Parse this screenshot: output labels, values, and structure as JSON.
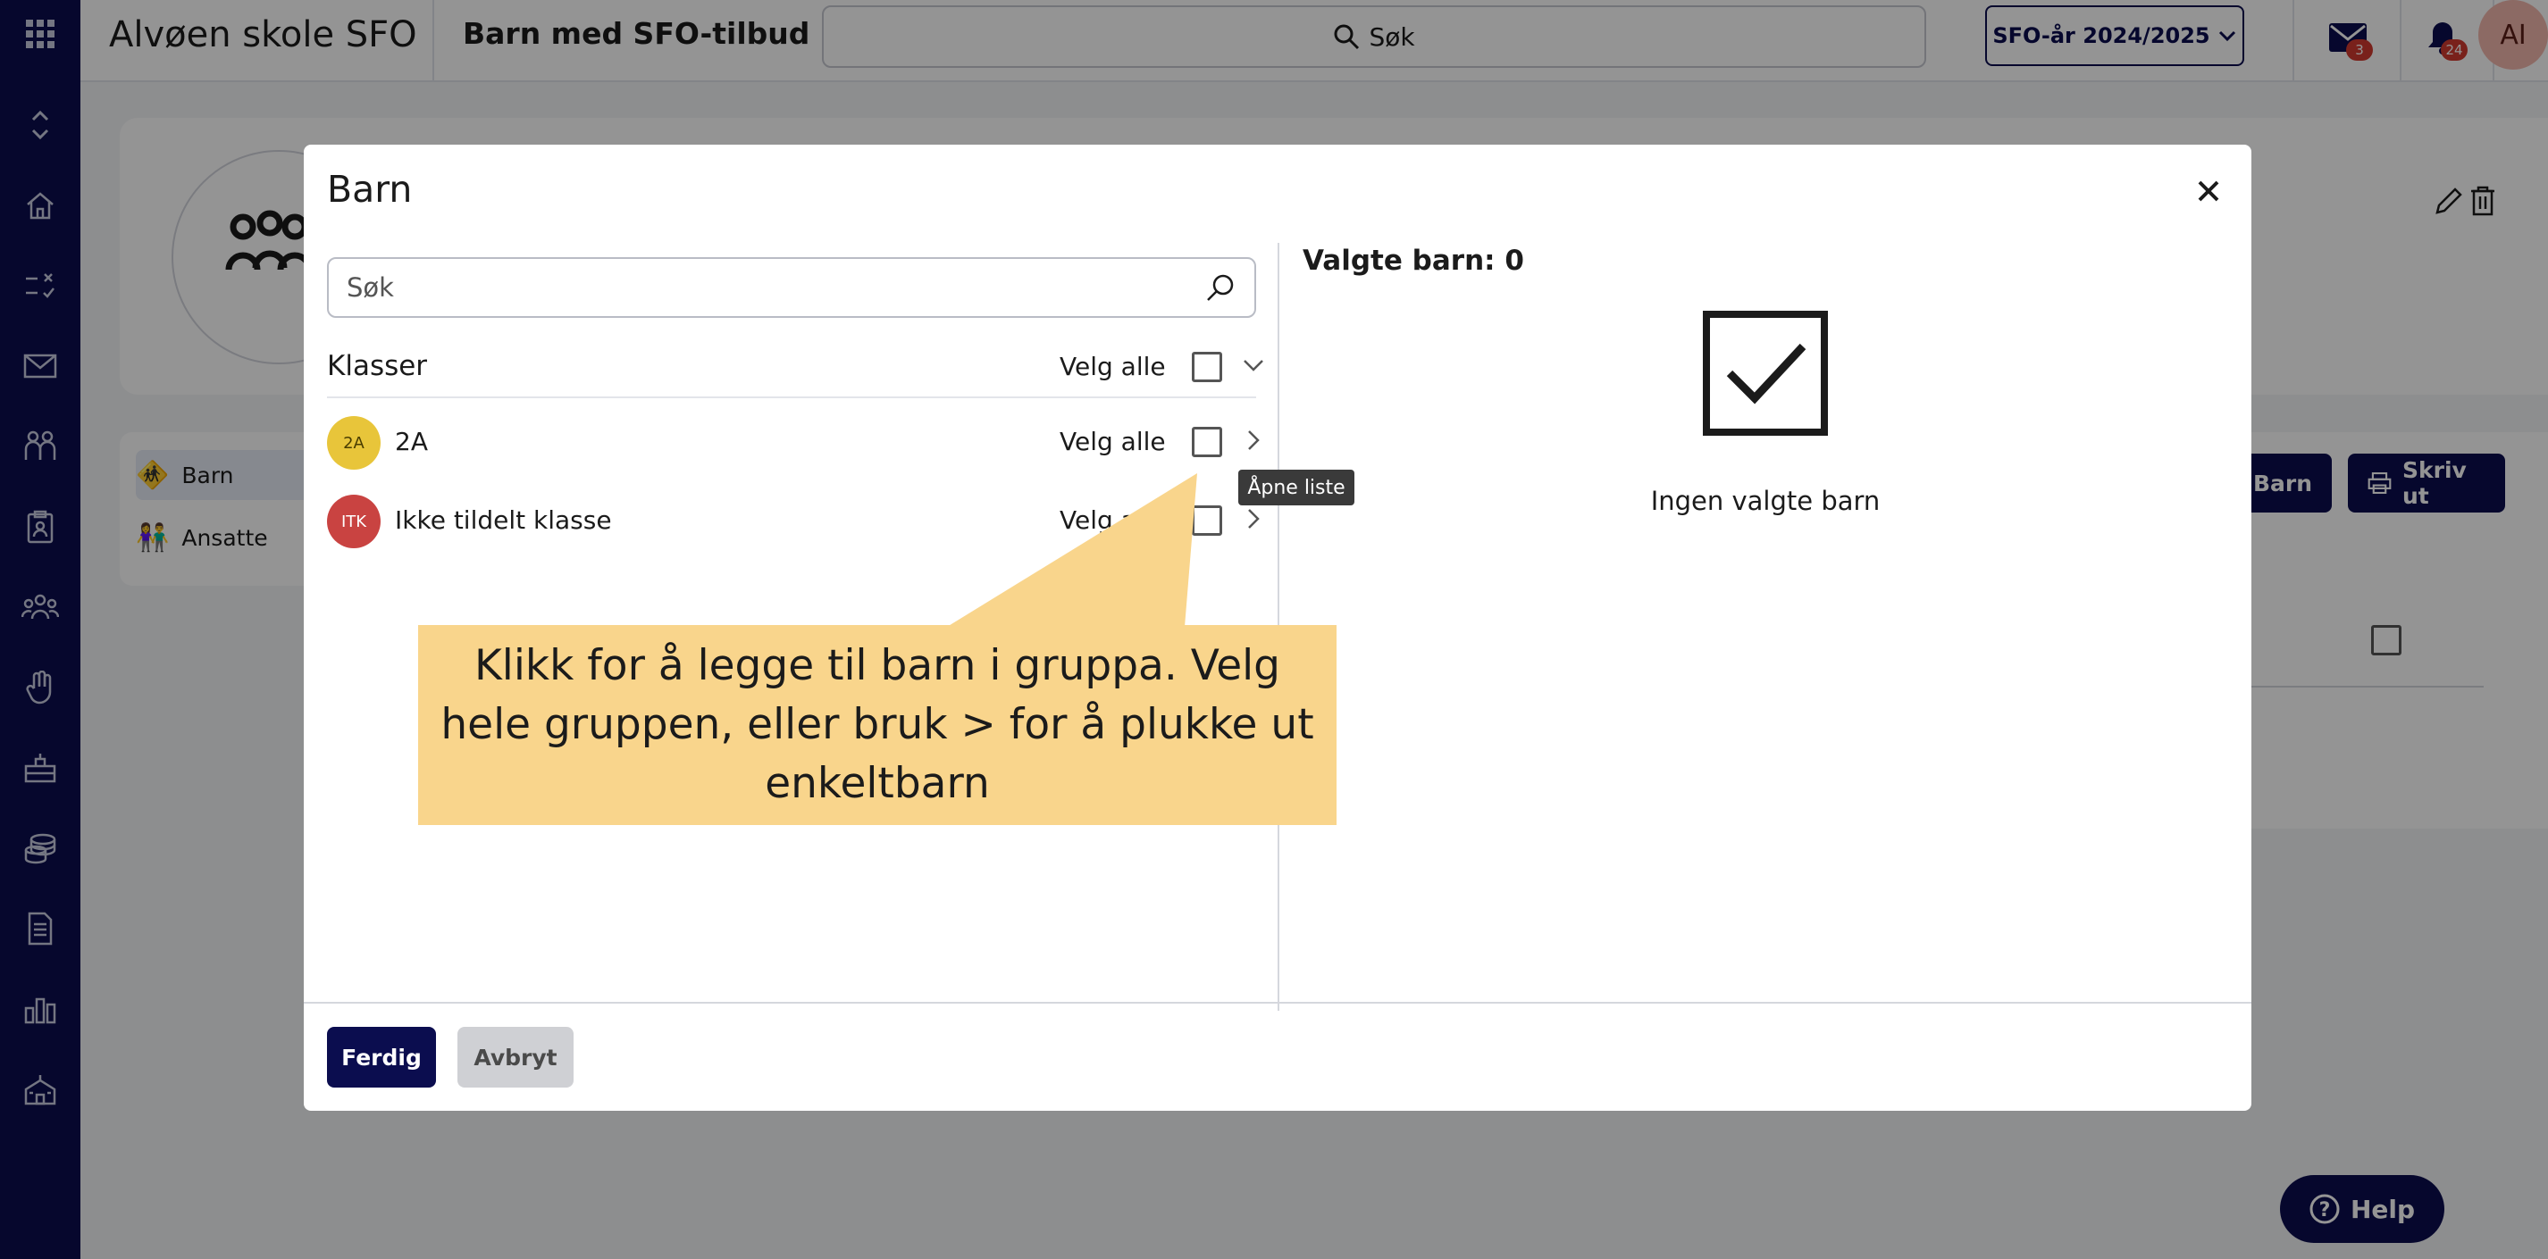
{
  "app": {
    "school_name": "Alvøen skole SFO",
    "page_title": "Barn med SFO-tilbud",
    "search_label": "Søk",
    "year_selector": "SFO-år 2024/2025",
    "messages_badge": "3",
    "notifications_badge": "24",
    "user_initials": "AI"
  },
  "sidebar": {
    "icons": [
      "apps-grid-icon",
      "collapse-icon",
      "home-icon",
      "tasks-icon",
      "mail-icon",
      "people-icon",
      "clipboard-icon",
      "group-icon",
      "hand-icon",
      "tools-icon",
      "coins-icon",
      "document-icon",
      "chart-icon",
      "school-icon"
    ]
  },
  "background": {
    "side_list": [
      "Barn",
      "Ansatte"
    ],
    "buttons": [
      "Barn",
      "Skriv ut"
    ],
    "help": "Help"
  },
  "modal": {
    "title": "Barn",
    "search_placeholder": "Søk",
    "section_title": "Klasser",
    "select_all": "Velg alle",
    "rows": [
      {
        "badge": "2A",
        "label": "2A",
        "select_all": "Velg alle",
        "badge_color": "#e8c53a"
      },
      {
        "badge": "ITK",
        "label": "Ikke tildelt klasse",
        "select_all": "Velg alle",
        "badge_color": "#c94341"
      }
    ],
    "selected_count_label": "Valgte barn: 0",
    "empty_text": "Ingen valgte barn",
    "done_button": "Ferdig",
    "cancel_button": "Avbryt"
  },
  "tooltip": "Åpne liste",
  "callout": "Klikk for å legge til barn i gruppa. Velg hele gruppen, eller bruk > for å plukke ut enkeltbarn",
  "colors": {
    "brand_navy": "#0b0d4f",
    "callout_yellow": "#f9d58c",
    "badge_red": "#d13a2f"
  }
}
